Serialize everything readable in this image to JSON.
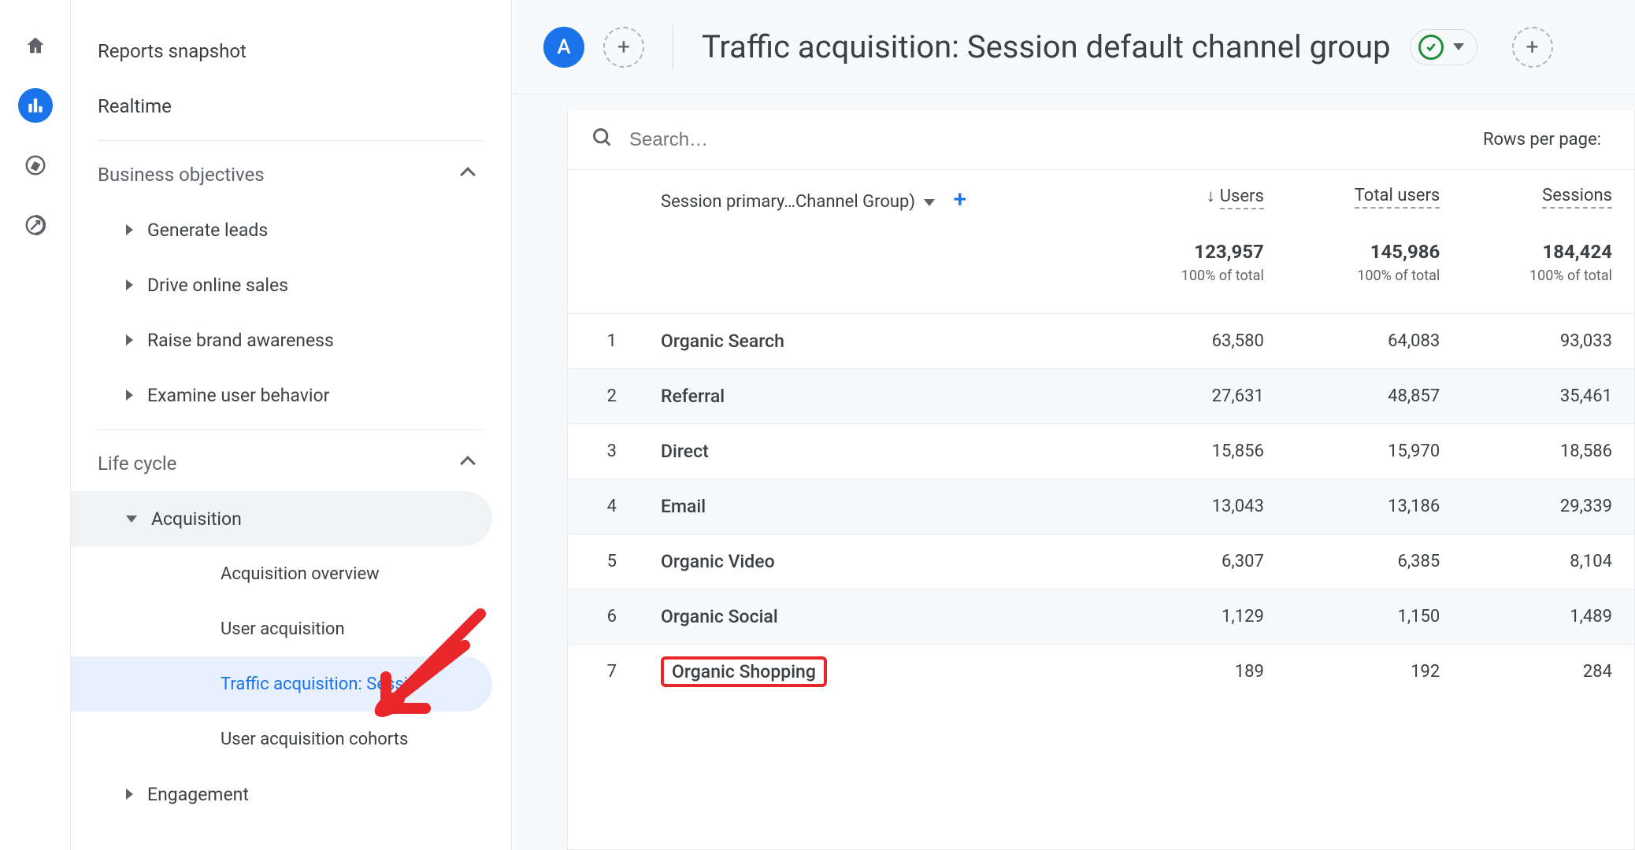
{
  "rail": {
    "home": "home",
    "reports": "reports",
    "explore": "explore",
    "ads": "ads"
  },
  "sidebar": {
    "snapshot": "Reports snapshot",
    "realtime": "Realtime",
    "section_business": "Business objectives",
    "items_business": [
      "Generate leads",
      "Drive online sales",
      "Raise brand awareness",
      "Examine user behavior"
    ],
    "section_lifecycle": "Life cycle",
    "acquisition": "Acquisition",
    "acq_children": [
      "Acquisition overview",
      "User acquisition",
      "Traffic acquisition: Sessi…",
      "User acquisition cohorts"
    ],
    "engagement": "Engagement"
  },
  "header": {
    "badge": "A",
    "title": "Traffic acquisition: Session default channel group"
  },
  "table": {
    "search_placeholder": "Search…",
    "rows_label": "Rows per page:",
    "dim_label": "Session primary…Channel Group)",
    "cols": [
      "Users",
      "Total users",
      "Sessions"
    ],
    "totals": {
      "values": [
        "123,957",
        "145,986",
        "184,424"
      ],
      "pct": "100% of total"
    },
    "rows": [
      {
        "n": "1",
        "dim": "Organic Search",
        "v": [
          "63,580",
          "64,083",
          "93,033"
        ]
      },
      {
        "n": "2",
        "dim": "Referral",
        "v": [
          "27,631",
          "48,857",
          "35,461"
        ]
      },
      {
        "n": "3",
        "dim": "Direct",
        "v": [
          "15,856",
          "15,970",
          "18,586"
        ]
      },
      {
        "n": "4",
        "dim": "Email",
        "v": [
          "13,043",
          "13,186",
          "29,339"
        ]
      },
      {
        "n": "5",
        "dim": "Organic Video",
        "v": [
          "6,307",
          "6,385",
          "8,104"
        ]
      },
      {
        "n": "6",
        "dim": "Organic Social",
        "v": [
          "1,129",
          "1,150",
          "1,489"
        ]
      },
      {
        "n": "7",
        "dim": "Organic Shopping",
        "v": [
          "189",
          "192",
          "284"
        ]
      }
    ]
  }
}
